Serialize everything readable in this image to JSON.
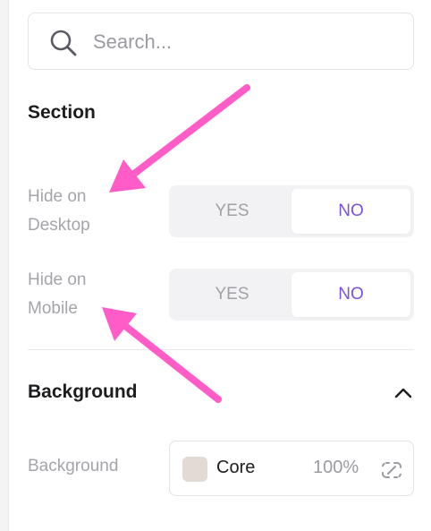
{
  "search": {
    "placeholder": "Search..."
  },
  "section": {
    "title": "Section"
  },
  "fields": {
    "hide_desktop": {
      "label_line1": "Hide on",
      "label_line2": "Desktop",
      "yes": "YES",
      "no": "NO",
      "selected": "NO"
    },
    "hide_mobile": {
      "label_line1": "Hide on",
      "label_line2": "Mobile",
      "yes": "YES",
      "no": "NO",
      "selected": "NO"
    }
  },
  "background": {
    "title": "Background",
    "field_label": "Background",
    "color_name": "Core",
    "opacity": "100%",
    "swatch_color": "#e2dbd4"
  },
  "colors": {
    "accent": "#7b4fe6",
    "annotation_arrow": "#ff5cc8"
  },
  "icons": {
    "search": "search-icon",
    "collapse": "chevron-up-icon",
    "unlink": "unlink-icon"
  }
}
